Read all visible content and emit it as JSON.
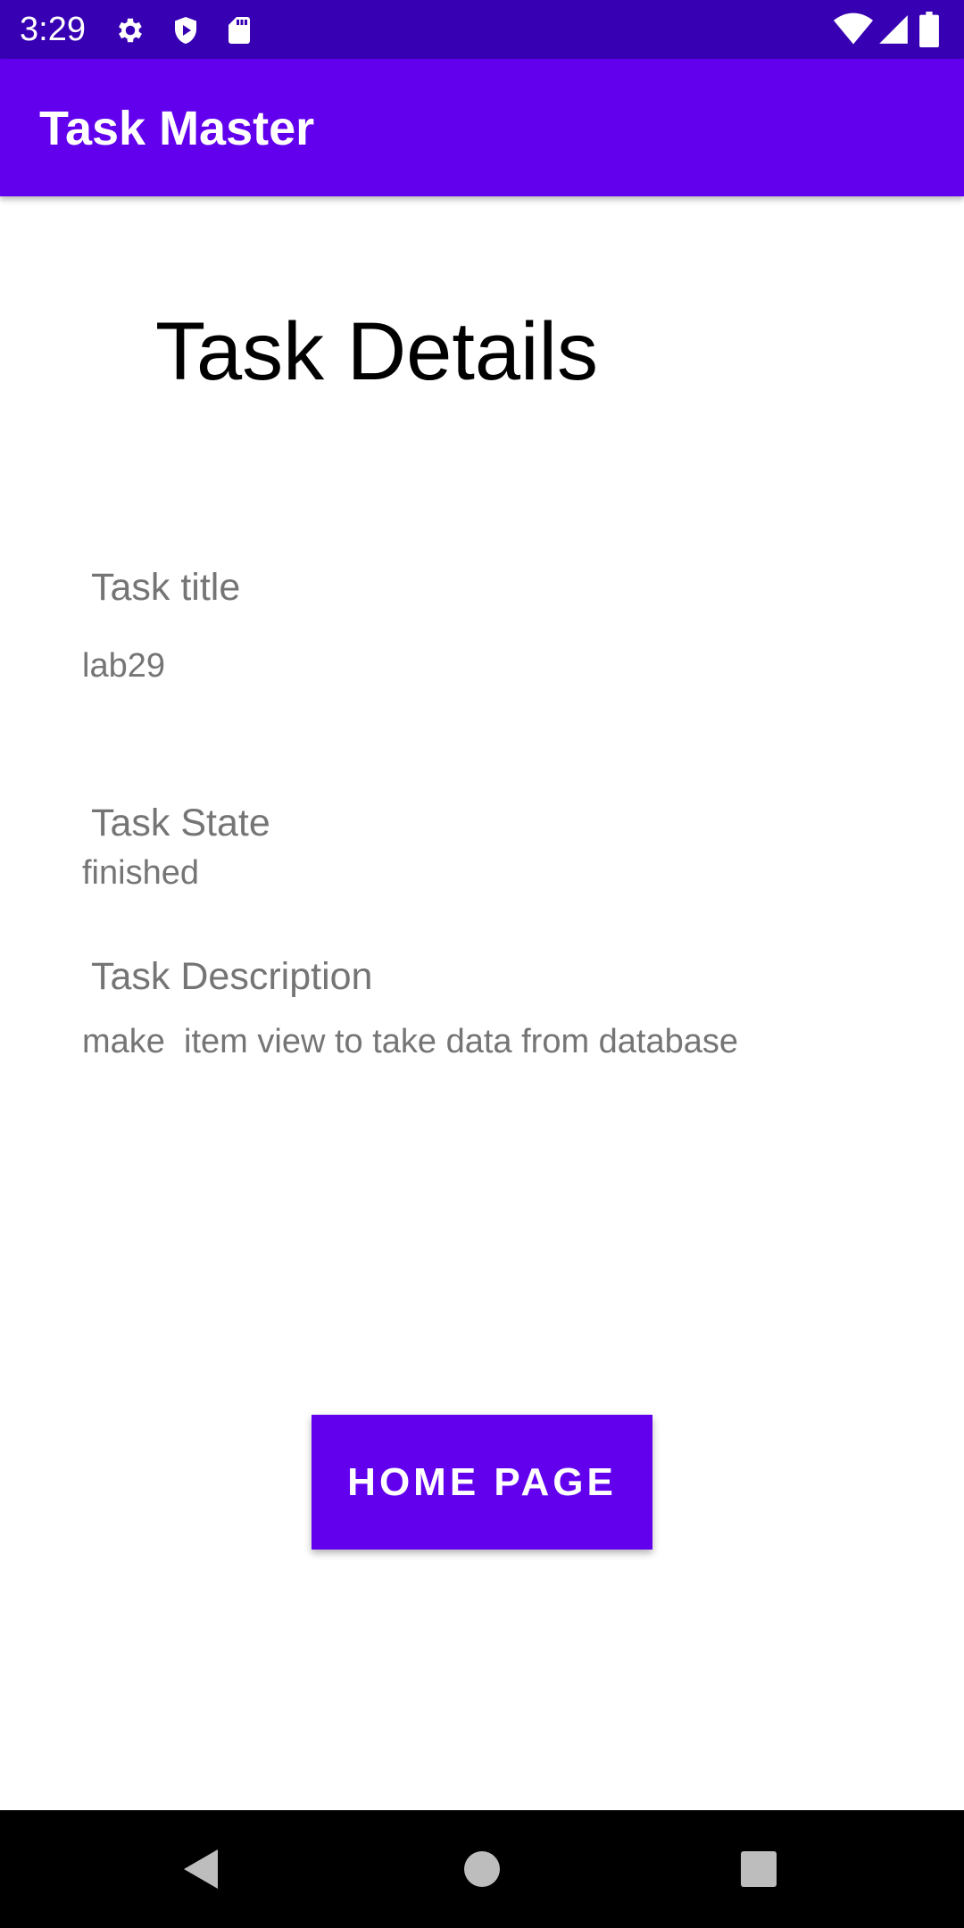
{
  "status_bar": {
    "time": "3:29",
    "icons": [
      "gear-icon",
      "shield-play-icon",
      "sd-card-icon",
      "wifi-icon",
      "signal-icon",
      "battery-icon"
    ],
    "background": "#3700b3"
  },
  "app_bar": {
    "title": "Task Master",
    "background": "#6200ee"
  },
  "main": {
    "heading": "Task Details",
    "fields": [
      {
        "label": "Task title",
        "value": "lab29"
      },
      {
        "label": "Task State",
        "value": "finished"
      },
      {
        "label": "Task Description",
        "value": "make  item view to take data from database"
      }
    ],
    "home_button_label": "HOME PAGE",
    "accent": "#6200ee"
  },
  "nav_bar": {
    "icons": [
      "back-icon",
      "home-icon",
      "recents-icon"
    ]
  }
}
